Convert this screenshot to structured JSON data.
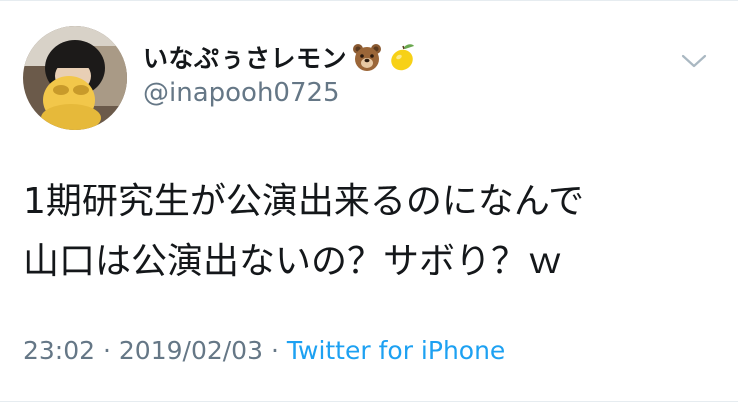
{
  "tweet": {
    "author": {
      "display_name": "いなぷぅさレモン",
      "name_emojis": [
        "bear-face-emoji",
        "lemon-emoji"
      ],
      "handle": "@inapooh0725"
    },
    "text_lines": [
      "1期研究生が公演出来るのになんで",
      "山口は公演出ないの？サボり？ｗ"
    ],
    "time": "23:02",
    "separator_1": "·",
    "date": "2019/02/03",
    "separator_2": "·",
    "source": "Twitter for iPhone"
  },
  "colors": {
    "text": "#14171a",
    "secondary": "#657786",
    "link": "#1da1f2",
    "divider": "#e6ecf0"
  }
}
